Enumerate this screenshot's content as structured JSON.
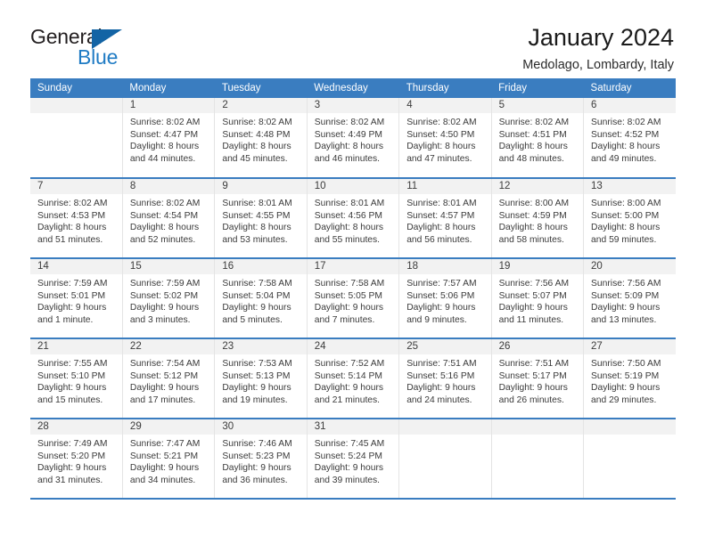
{
  "brand": {
    "name_part1": "General",
    "name_part2": "Blue",
    "triangle_icon": "triangle-icon"
  },
  "header": {
    "month_title": "January 2024",
    "location": "Medolago, Lombardy, Italy"
  },
  "colors": {
    "header_blue": "#3a7dc0",
    "brand_blue": "#1f7bc4",
    "daynum_bg": "#f2f2f2",
    "text": "#3a3a3a"
  },
  "weekdays": [
    "Sunday",
    "Monday",
    "Tuesday",
    "Wednesday",
    "Thursday",
    "Friday",
    "Saturday"
  ],
  "weeks": [
    [
      {
        "day": "",
        "sunrise": "",
        "sunset": "",
        "daylight1": "",
        "daylight2": ""
      },
      {
        "day": "1",
        "sunrise": "Sunrise: 8:02 AM",
        "sunset": "Sunset: 4:47 PM",
        "daylight1": "Daylight: 8 hours",
        "daylight2": "and 44 minutes."
      },
      {
        "day": "2",
        "sunrise": "Sunrise: 8:02 AM",
        "sunset": "Sunset: 4:48 PM",
        "daylight1": "Daylight: 8 hours",
        "daylight2": "and 45 minutes."
      },
      {
        "day": "3",
        "sunrise": "Sunrise: 8:02 AM",
        "sunset": "Sunset: 4:49 PM",
        "daylight1": "Daylight: 8 hours",
        "daylight2": "and 46 minutes."
      },
      {
        "day": "4",
        "sunrise": "Sunrise: 8:02 AM",
        "sunset": "Sunset: 4:50 PM",
        "daylight1": "Daylight: 8 hours",
        "daylight2": "and 47 minutes."
      },
      {
        "day": "5",
        "sunrise": "Sunrise: 8:02 AM",
        "sunset": "Sunset: 4:51 PM",
        "daylight1": "Daylight: 8 hours",
        "daylight2": "and 48 minutes."
      },
      {
        "day": "6",
        "sunrise": "Sunrise: 8:02 AM",
        "sunset": "Sunset: 4:52 PM",
        "daylight1": "Daylight: 8 hours",
        "daylight2": "and 49 minutes."
      }
    ],
    [
      {
        "day": "7",
        "sunrise": "Sunrise: 8:02 AM",
        "sunset": "Sunset: 4:53 PM",
        "daylight1": "Daylight: 8 hours",
        "daylight2": "and 51 minutes."
      },
      {
        "day": "8",
        "sunrise": "Sunrise: 8:02 AM",
        "sunset": "Sunset: 4:54 PM",
        "daylight1": "Daylight: 8 hours",
        "daylight2": "and 52 minutes."
      },
      {
        "day": "9",
        "sunrise": "Sunrise: 8:01 AM",
        "sunset": "Sunset: 4:55 PM",
        "daylight1": "Daylight: 8 hours",
        "daylight2": "and 53 minutes."
      },
      {
        "day": "10",
        "sunrise": "Sunrise: 8:01 AM",
        "sunset": "Sunset: 4:56 PM",
        "daylight1": "Daylight: 8 hours",
        "daylight2": "and 55 minutes."
      },
      {
        "day": "11",
        "sunrise": "Sunrise: 8:01 AM",
        "sunset": "Sunset: 4:57 PM",
        "daylight1": "Daylight: 8 hours",
        "daylight2": "and 56 minutes."
      },
      {
        "day": "12",
        "sunrise": "Sunrise: 8:00 AM",
        "sunset": "Sunset: 4:59 PM",
        "daylight1": "Daylight: 8 hours",
        "daylight2": "and 58 minutes."
      },
      {
        "day": "13",
        "sunrise": "Sunrise: 8:00 AM",
        "sunset": "Sunset: 5:00 PM",
        "daylight1": "Daylight: 8 hours",
        "daylight2": "and 59 minutes."
      }
    ],
    [
      {
        "day": "14",
        "sunrise": "Sunrise: 7:59 AM",
        "sunset": "Sunset: 5:01 PM",
        "daylight1": "Daylight: 9 hours",
        "daylight2": "and 1 minute."
      },
      {
        "day": "15",
        "sunrise": "Sunrise: 7:59 AM",
        "sunset": "Sunset: 5:02 PM",
        "daylight1": "Daylight: 9 hours",
        "daylight2": "and 3 minutes."
      },
      {
        "day": "16",
        "sunrise": "Sunrise: 7:58 AM",
        "sunset": "Sunset: 5:04 PM",
        "daylight1": "Daylight: 9 hours",
        "daylight2": "and 5 minutes."
      },
      {
        "day": "17",
        "sunrise": "Sunrise: 7:58 AM",
        "sunset": "Sunset: 5:05 PM",
        "daylight1": "Daylight: 9 hours",
        "daylight2": "and 7 minutes."
      },
      {
        "day": "18",
        "sunrise": "Sunrise: 7:57 AM",
        "sunset": "Sunset: 5:06 PM",
        "daylight1": "Daylight: 9 hours",
        "daylight2": "and 9 minutes."
      },
      {
        "day": "19",
        "sunrise": "Sunrise: 7:56 AM",
        "sunset": "Sunset: 5:07 PM",
        "daylight1": "Daylight: 9 hours",
        "daylight2": "and 11 minutes."
      },
      {
        "day": "20",
        "sunrise": "Sunrise: 7:56 AM",
        "sunset": "Sunset: 5:09 PM",
        "daylight1": "Daylight: 9 hours",
        "daylight2": "and 13 minutes."
      }
    ],
    [
      {
        "day": "21",
        "sunrise": "Sunrise: 7:55 AM",
        "sunset": "Sunset: 5:10 PM",
        "daylight1": "Daylight: 9 hours",
        "daylight2": "and 15 minutes."
      },
      {
        "day": "22",
        "sunrise": "Sunrise: 7:54 AM",
        "sunset": "Sunset: 5:12 PM",
        "daylight1": "Daylight: 9 hours",
        "daylight2": "and 17 minutes."
      },
      {
        "day": "23",
        "sunrise": "Sunrise: 7:53 AM",
        "sunset": "Sunset: 5:13 PM",
        "daylight1": "Daylight: 9 hours",
        "daylight2": "and 19 minutes."
      },
      {
        "day": "24",
        "sunrise": "Sunrise: 7:52 AM",
        "sunset": "Sunset: 5:14 PM",
        "daylight1": "Daylight: 9 hours",
        "daylight2": "and 21 minutes."
      },
      {
        "day": "25",
        "sunrise": "Sunrise: 7:51 AM",
        "sunset": "Sunset: 5:16 PM",
        "daylight1": "Daylight: 9 hours",
        "daylight2": "and 24 minutes."
      },
      {
        "day": "26",
        "sunrise": "Sunrise: 7:51 AM",
        "sunset": "Sunset: 5:17 PM",
        "daylight1": "Daylight: 9 hours",
        "daylight2": "and 26 minutes."
      },
      {
        "day": "27",
        "sunrise": "Sunrise: 7:50 AM",
        "sunset": "Sunset: 5:19 PM",
        "daylight1": "Daylight: 9 hours",
        "daylight2": "and 29 minutes."
      }
    ],
    [
      {
        "day": "28",
        "sunrise": "Sunrise: 7:49 AM",
        "sunset": "Sunset: 5:20 PM",
        "daylight1": "Daylight: 9 hours",
        "daylight2": "and 31 minutes."
      },
      {
        "day": "29",
        "sunrise": "Sunrise: 7:47 AM",
        "sunset": "Sunset: 5:21 PM",
        "daylight1": "Daylight: 9 hours",
        "daylight2": "and 34 minutes."
      },
      {
        "day": "30",
        "sunrise": "Sunrise: 7:46 AM",
        "sunset": "Sunset: 5:23 PM",
        "daylight1": "Daylight: 9 hours",
        "daylight2": "and 36 minutes."
      },
      {
        "day": "31",
        "sunrise": "Sunrise: 7:45 AM",
        "sunset": "Sunset: 5:24 PM",
        "daylight1": "Daylight: 9 hours",
        "daylight2": "and 39 minutes."
      },
      {
        "day": "",
        "sunrise": "",
        "sunset": "",
        "daylight1": "",
        "daylight2": ""
      },
      {
        "day": "",
        "sunrise": "",
        "sunset": "",
        "daylight1": "",
        "daylight2": ""
      },
      {
        "day": "",
        "sunrise": "",
        "sunset": "",
        "daylight1": "",
        "daylight2": ""
      }
    ]
  ]
}
